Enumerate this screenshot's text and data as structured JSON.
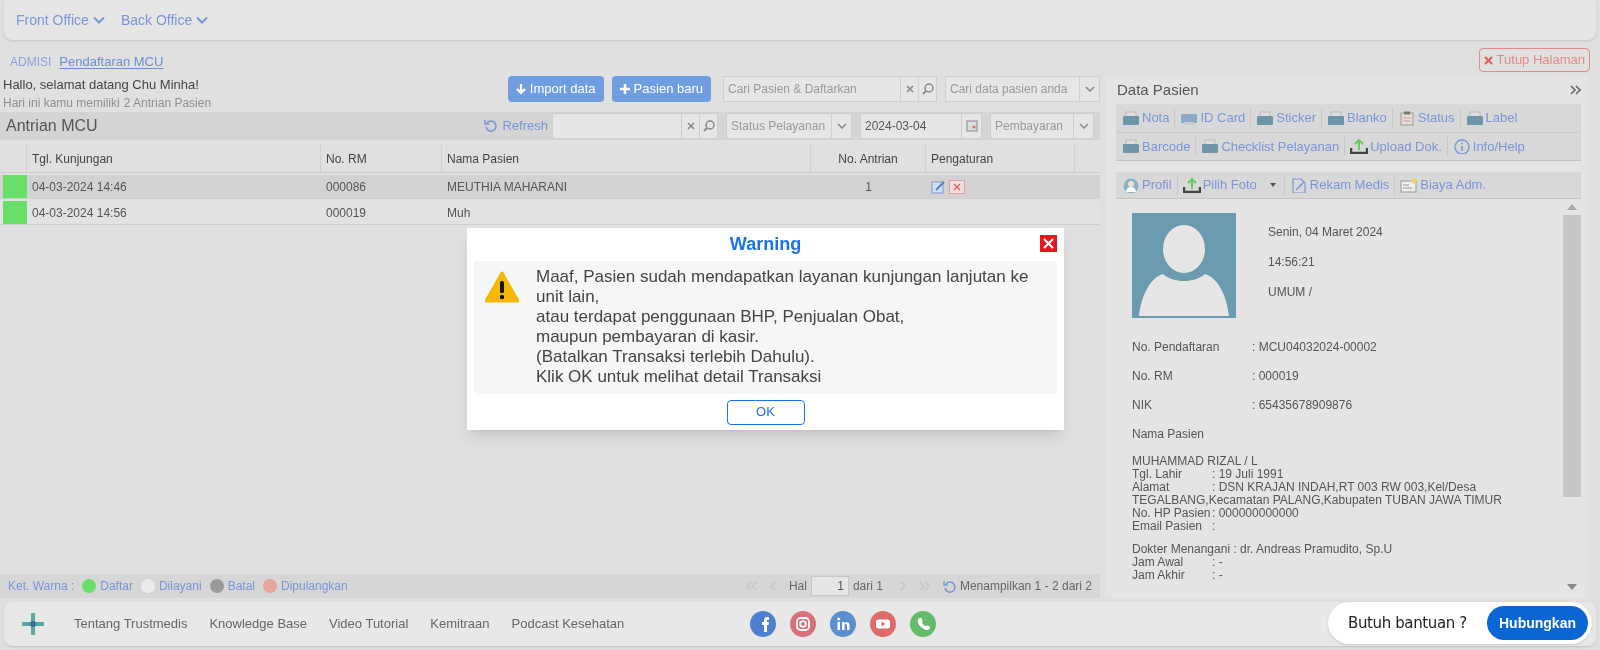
{
  "nav": [
    {
      "label": "Front Office"
    },
    {
      "label": "Back Office"
    }
  ],
  "breadcrumb": [
    {
      "label": "ADMISI",
      "selected": false
    },
    {
      "label": "Pendaftaran MCU",
      "selected": true
    }
  ],
  "close_page_button": "Tutup Halaman",
  "greeting": "Hallo, selamat datang Chu Minha!",
  "summary": {
    "prefix": "Hari ini kamu memiliki",
    "count": "2 Antrian Pasien"
  },
  "actions": [
    {
      "kind": "import",
      "label": "Import data"
    },
    {
      "kind": "add",
      "label": "Pasien baru"
    }
  ],
  "patient_search": {
    "placeholder": "Cari Pasien & Daftarkan"
  },
  "patient_lookup": {
    "placeholder": "Cari data pasien anda"
  },
  "queue": {
    "title": "Antrian MCU",
    "refresh": "Refresh",
    "status_filter": {
      "placeholder": "Status Pelayanan"
    },
    "date": "2024-03-04",
    "payment_filter": {
      "placeholder": "Pembayaran"
    }
  },
  "table": {
    "columns": [
      "Tgl. Kunjungan",
      "No. RM",
      "Nama Pasien",
      "No. Antrian",
      "Pengaturan"
    ],
    "rows": [
      {
        "color": "#66e066",
        "selected": true,
        "cells": [
          "04-03-2024 14:46",
          "000086",
          "MEUTHIA MAHARANI",
          "1"
        ]
      },
      {
        "color": "#66e066",
        "selected": false,
        "cells": [
          "04-03-2024 14:56",
          "000019",
          "Muh",
          ""
        ]
      }
    ]
  },
  "legend": {
    "label": "Ket. Warna :",
    "items": [
      {
        "label": "Daftar",
        "color": "#66e066"
      },
      {
        "label": "Dilayani",
        "color": "#ebebeb"
      },
      {
        "label": "Batal",
        "color": "#9a9a9a"
      },
      {
        "label": "Dipulangkan",
        "color": "#e8a59a"
      }
    ]
  },
  "pagination": {
    "page_label": "Hal",
    "page": "1",
    "of": "dari 1",
    "summary": "Menampilkan 1 - 2 dari 2"
  },
  "patient": {
    "title": "Data Pasien",
    "toolbar": [
      [
        {
          "kind": "print",
          "label": "Nota"
        },
        {
          "kind": "card",
          "label": "ID Card"
        },
        {
          "kind": "print",
          "label": "Sticker"
        },
        {
          "kind": "print",
          "label": "Blanko"
        },
        {
          "kind": "status",
          "label": "Status"
        },
        {
          "kind": "print",
          "label": "Label"
        }
      ],
      [
        {
          "kind": "print",
          "label": "Barcode"
        },
        {
          "kind": "print",
          "label": "Checklist Pelayanan"
        },
        {
          "kind": "upload",
          "label": "Upload Dok."
        },
        {
          "kind": "info",
          "label": "Info/Help"
        }
      ]
    ],
    "tabs": [
      {
        "kind": "profile",
        "label": "Profil"
      },
      {
        "kind": "photo",
        "label": "Pilih Foto"
      },
      {
        "kind": "record",
        "label": "Rekam Medis"
      },
      {
        "kind": "fee",
        "label": "Biaya Adm."
      }
    ],
    "date": "Senin, 04 Maret 2024",
    "time": "14:56:21",
    "payer": "UMUM /",
    "fields": [
      {
        "label": "No. Pendaftaran",
        "value": ": MCU04032024-00002"
      },
      {
        "label": "No. RM",
        "value": ": 000019"
      },
      {
        "label": "NIK",
        "value": ": 65435678909876"
      }
    ],
    "name_label": "Nama Pasien",
    "name": "MUHAMMAD RIZAL / L",
    "details": [
      {
        "label": "Tgl. Lahir",
        "value": ": 19 Juli 1991"
      },
      {
        "label": "Alamat",
        "value": ": DSN KRAJAN INDAH,RT 003 RW 003,Kel/Desa TEGALBANG,Kecamatan PALANG,Kabupaten TUBAN JAWA TIMUR"
      },
      {
        "label": "No. HP Pasien",
        "value": ": 000000000000"
      },
      {
        "label": "Email Pasien",
        "value": ":"
      }
    ],
    "doctor_label": "Dokter Menangani",
    "doctor": ": dr. Andreas Pramudito, Sp.U",
    "times": [
      {
        "label": "Jam Awal",
        "value": ": -"
      },
      {
        "label": "Jam Akhir",
        "value": ": -"
      }
    ]
  },
  "footer": {
    "links": [
      "Tentang Trustmedis",
      "Knowledge Base",
      "Video Tutorial",
      "Kemitraan",
      "Podcast Kesehatan"
    ],
    "socials": [
      {
        "kind": "facebook",
        "color": "#4f7fd0"
      },
      {
        "kind": "instagram",
        "color": "#d9707a"
      },
      {
        "kind": "linkedin",
        "color": "#5b8fd0"
      },
      {
        "kind": "youtube",
        "color": "#dd6b6b"
      },
      {
        "kind": "phone",
        "color": "#66bb6a"
      }
    ]
  },
  "help": {
    "text": "Butuh bantuan ?",
    "button": "Hubungkan"
  },
  "dialog": {
    "title": "Warning",
    "lines": [
      "Maaf, Pasien sudah mendapatkan layanan kunjungan lanjutan ke unit lain,",
      "atau terdapat penggunaan BHP, Penjualan Obat,",
      "maupun pembayaran di kasir.",
      "(Batalkan Transaksi terlebih Dahulu).",
      "Klik OK untuk melihat detail Transaksi"
    ],
    "ok": "OK"
  }
}
